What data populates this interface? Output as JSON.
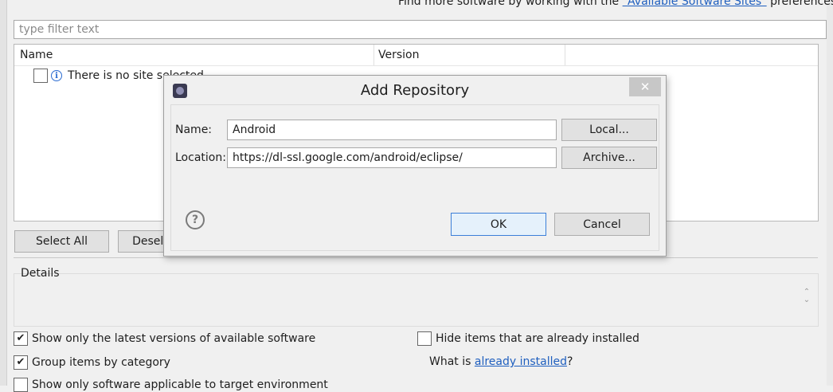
{
  "header": {
    "info_prefix": "Find more software by working with the ",
    "info_link": "\"Available Software Sites\"",
    "info_suffix": " preferences."
  },
  "filter": {
    "placeholder": "type filter text",
    "value": ""
  },
  "table": {
    "columns": [
      "Name",
      "Version"
    ],
    "rows": [
      {
        "checked": false,
        "icon": "info-icon",
        "label": "There is no site selected."
      }
    ]
  },
  "buttons": {
    "select_all": "Select All",
    "deselect_all": "Deselect All"
  },
  "details": {
    "label": "Details"
  },
  "options": {
    "show_latest": {
      "label": "Show only the latest versions of available software",
      "checked": true
    },
    "group_by_category": {
      "label": "Group items by category",
      "checked": true
    },
    "show_applicable": {
      "label": "Show only software applicable to target environment",
      "checked": false
    },
    "hide_installed": {
      "label": "Hide items that are already installed",
      "checked": false
    }
  },
  "installed": {
    "prefix": "What is ",
    "link": "already installed",
    "suffix": "?"
  },
  "dialog": {
    "title": "Add Repository",
    "close_icon": "close-icon",
    "app_icon": "eclipse-icon",
    "name_label": "Name:",
    "name_value": "Android",
    "location_label": "Location:",
    "location_value": "https://dl-ssl.google.com/android/eclipse/",
    "local_button": "Local...",
    "archive_button": "Archive...",
    "ok_button": "OK",
    "cancel_button": "Cancel",
    "help_icon": "help-icon"
  },
  "colors": {
    "link": "#1f5fbf",
    "default_button_border": "#3c7fd8",
    "window_bg": "#f0f0f0"
  }
}
